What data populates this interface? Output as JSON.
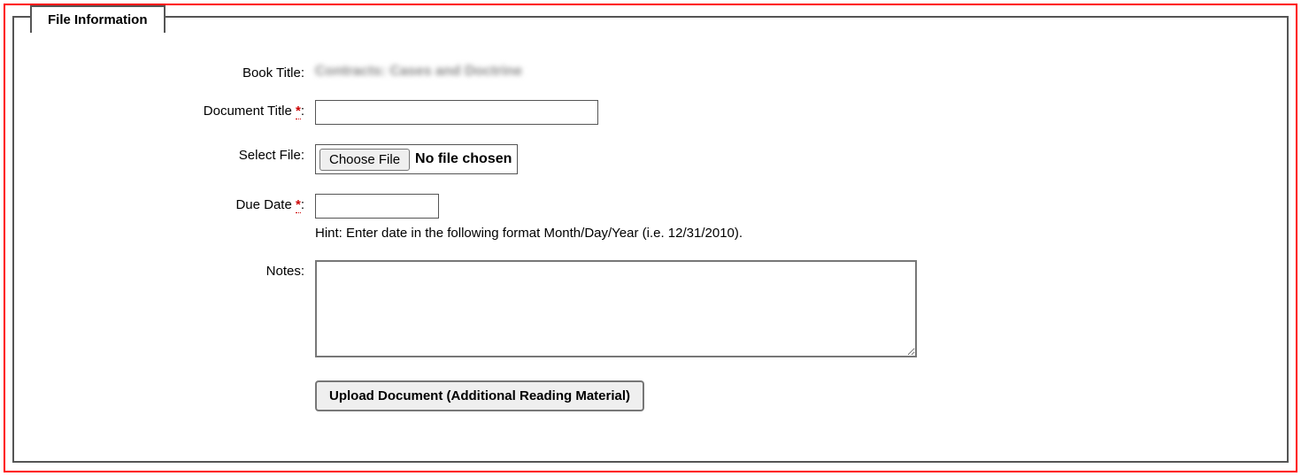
{
  "fieldset": {
    "legend": "File Information"
  },
  "form": {
    "book_title": {
      "label": "Book Title:",
      "value": "Contracts: Cases and Doctrine"
    },
    "document_title": {
      "label_prefix": "Document Title ",
      "required_mark": "*",
      "label_suffix": ":",
      "value": ""
    },
    "select_file": {
      "label": "Select File:",
      "button": "Choose File",
      "no_file": "No file chosen"
    },
    "due_date": {
      "label_prefix": "Due Date ",
      "required_mark": "*",
      "label_suffix": ":",
      "value": "",
      "hint": "Hint: Enter date in the following format Month/Day/Year (i.e. 12/31/2010)."
    },
    "notes": {
      "label": "Notes:",
      "value": ""
    },
    "submit": {
      "label": "Upload Document (Additional Reading Material)"
    }
  }
}
